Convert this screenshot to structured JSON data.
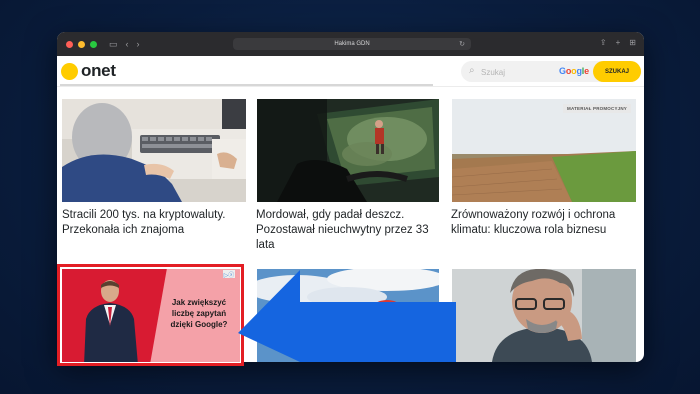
{
  "browser": {
    "address": "Hakima GDN",
    "nav_back": "‹",
    "nav_forward": "›"
  },
  "header": {
    "logo_text": "onet",
    "search_placeholder": "Szukaj",
    "google_letters": [
      "G",
      "o",
      "o",
      "g",
      "l",
      "e"
    ],
    "google_colors": [
      "#4285F4",
      "#EA4335",
      "#FBBC05",
      "#4285F4",
      "#34A853",
      "#EA4335"
    ],
    "search_button": "SZUKAJ"
  },
  "articles": [
    {
      "title": "Stracili 200 tys. na kryptowaluty. Przekonała ich znajoma"
    },
    {
      "title": "Mordował, gdy padał deszcz. Pozostawał nieuchwytny przez 33 lata"
    },
    {
      "title": "Zrównoważony rozwój i ochrona klimatu: kluczowa rola biznesu",
      "tag": "MATERIAŁ PROMOCYJNY"
    }
  ],
  "ad": {
    "text": "Jak zwiększyć liczbę zapytań dzięki Google?",
    "badge": "▷ⓧ"
  },
  "colors": {
    "brand_yellow": "#ffcc00",
    "ad_red": "#d81b32",
    "arrow_blue": "#1565e0"
  }
}
